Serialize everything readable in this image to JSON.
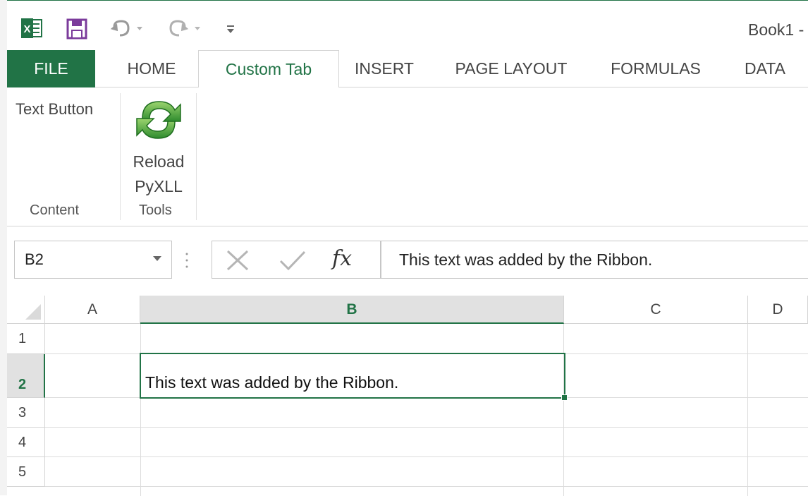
{
  "window": {
    "title": "Book1 -"
  },
  "quick_access": {
    "icons": [
      "excel-logo",
      "save-icon",
      "undo-icon",
      "redo-icon",
      "customize-icon"
    ],
    "accent_color": "#217346"
  },
  "tabs": [
    {
      "id": "file",
      "label": "FILE"
    },
    {
      "id": "home",
      "label": "HOME"
    },
    {
      "id": "custom",
      "label": "Custom Tab",
      "active": true
    },
    {
      "id": "insert",
      "label": "INSERT"
    },
    {
      "id": "pagelayout",
      "label": "PAGE LAYOUT"
    },
    {
      "id": "formulas",
      "label": "FORMULAS"
    },
    {
      "id": "data",
      "label": "DATA"
    }
  ],
  "ribbon": {
    "groups": [
      {
        "label": "Content",
        "buttons": [
          {
            "label": "Text Button"
          }
        ]
      },
      {
        "label": "Tools",
        "buttons": [
          {
            "label_line1": "Reload",
            "label_line2": "PyXLL",
            "icon": "reload-icon"
          }
        ]
      }
    ]
  },
  "formula_bar": {
    "name_box": "B2",
    "formula": "This text was added by the Ribbon.",
    "fx_label": "fx"
  },
  "sheet": {
    "columns": [
      "A",
      "B",
      "C",
      "D"
    ],
    "selected_column": "B",
    "rows": [
      "1",
      "2",
      "3",
      "4",
      "5"
    ],
    "selected_row": "2",
    "active_cell": "B2",
    "cells": {
      "B2": "This text was added by the Ribbon."
    }
  }
}
